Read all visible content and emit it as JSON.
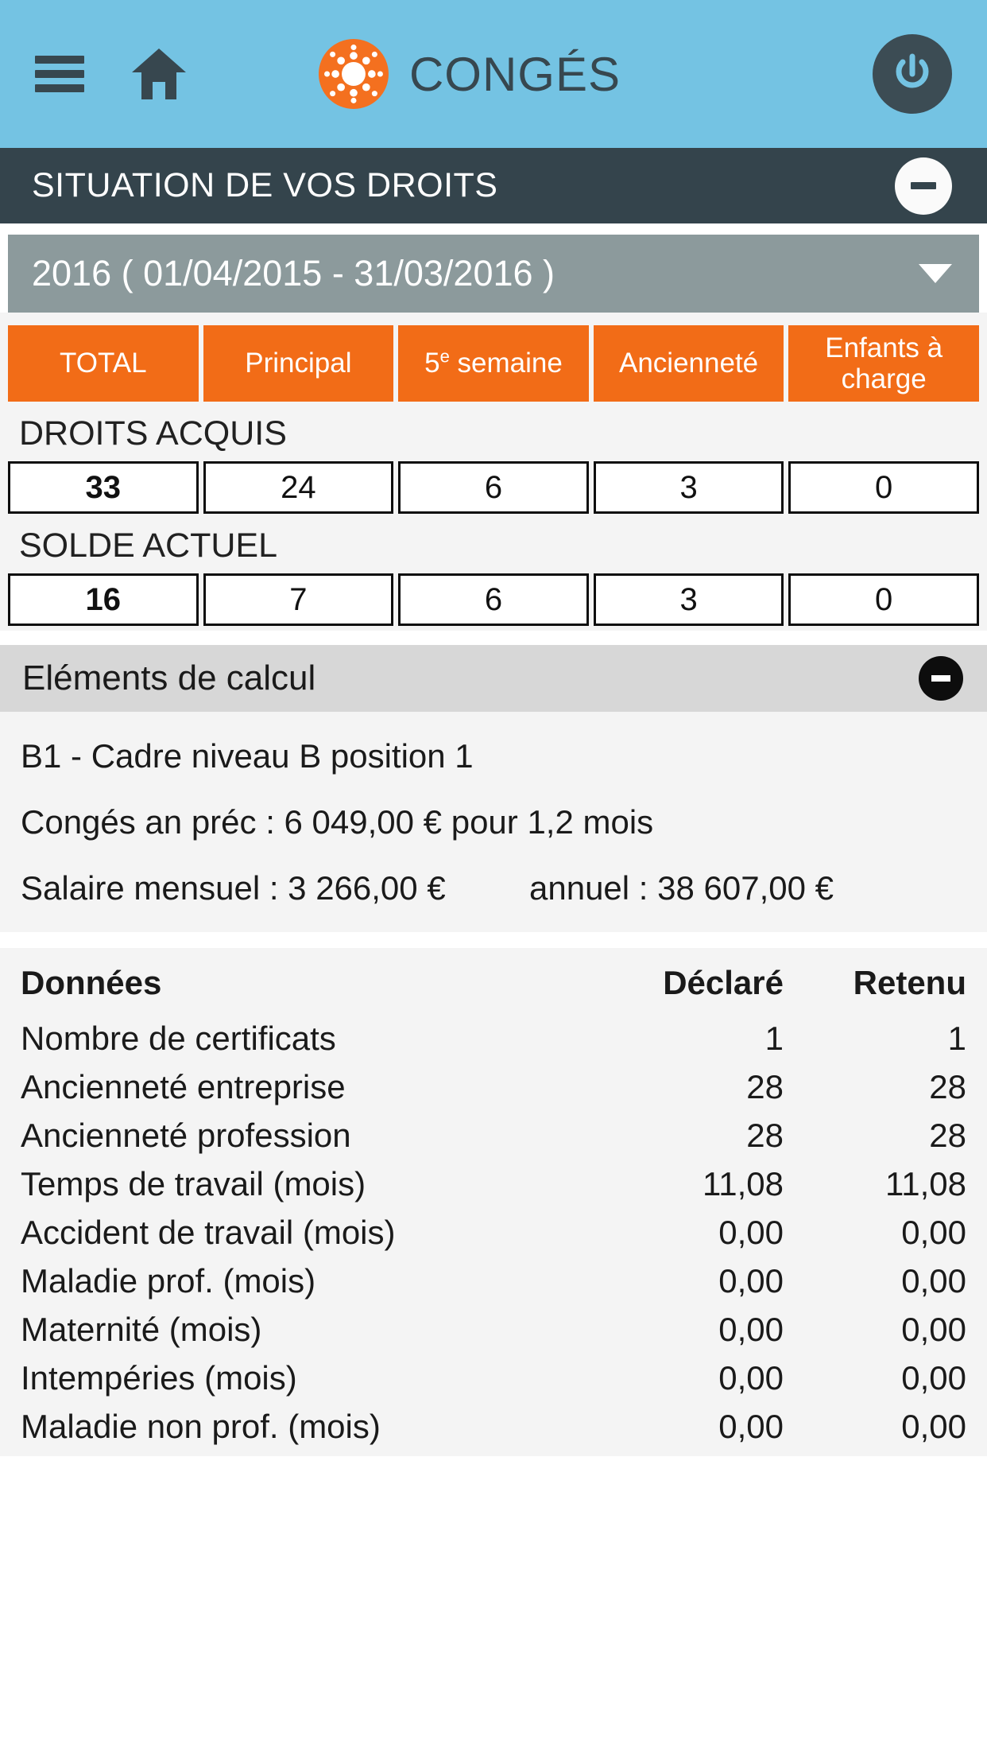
{
  "appbar": {
    "menu_icon": "hamburger-icon",
    "home_icon": "home-icon",
    "logo_icon": "sun-logo-icon",
    "title": "CONGÉS",
    "power_icon": "power-icon"
  },
  "section": {
    "title": "SITUATION DE VOS DROITS",
    "collapse_icon": "minus-circle-icon"
  },
  "year_select": {
    "value": "2016 ( 01/04/2015 - 31/03/2016 )",
    "caret_icon": "chevron-down-icon"
  },
  "rights": {
    "columns": [
      {
        "label": "TOTAL",
        "sup": ""
      },
      {
        "label": "Principal",
        "sup": ""
      },
      {
        "label": "5",
        "sup": "e",
        "suffix": " semaine"
      },
      {
        "label": "Ancienneté",
        "sup": ""
      },
      {
        "label": "Enfants à charge",
        "sup": ""
      }
    ],
    "column_labels": [
      "TOTAL",
      "Principal",
      "5e semaine",
      "Ancienneté",
      "Enfants à charge"
    ],
    "acquired_caption": "DROITS ACQUIS",
    "acquired_values": [
      "33",
      "24",
      "6",
      "3",
      "0"
    ],
    "balance_caption": "SOLDE ACTUEL",
    "balance_values": [
      "16",
      "7",
      "6",
      "3",
      "0"
    ]
  },
  "calc": {
    "title": "Eléments de calcul",
    "collapse_icon": "minus-circle-icon",
    "line_category": "B1 - Cadre niveau B position 1",
    "line_prev_leave": "Congés an préc : 6 049,00 € pour 1,2 mois",
    "line_salary_monthly": "Salaire mensuel : 3 266,00 €",
    "line_salary_annual": "annuel : 38 607,00 €"
  },
  "data_table": {
    "headers": {
      "label": "Données",
      "declared": "Déclaré",
      "retained": "Retenu"
    },
    "rows": [
      {
        "label": "Nombre de certificats",
        "declared": "1",
        "retained": "1"
      },
      {
        "label": "Ancienneté entreprise",
        "declared": "28",
        "retained": "28"
      },
      {
        "label": "Ancienneté profession",
        "declared": "28",
        "retained": "28"
      },
      {
        "label": "Temps de travail (mois)",
        "declared": "11,08",
        "retained": "11,08"
      },
      {
        "label": "Accident de travail (mois)",
        "declared": "0,00",
        "retained": "0,00"
      },
      {
        "label": "Maladie prof. (mois)",
        "declared": "0,00",
        "retained": "0,00"
      },
      {
        "label": "Maternité (mois)",
        "declared": "0,00",
        "retained": "0,00"
      },
      {
        "label": "Intempéries (mois)",
        "declared": "0,00",
        "retained": "0,00"
      },
      {
        "label": "Maladie non prof. (mois)",
        "declared": "0,00",
        "retained": "0,00"
      }
    ]
  },
  "colors": {
    "appbar_blue": "#74c3e3",
    "dark_slate": "#34444c",
    "orange": "#f26c17",
    "grey_select": "#8c9a9c",
    "panel_grey": "#f4f4f4"
  }
}
